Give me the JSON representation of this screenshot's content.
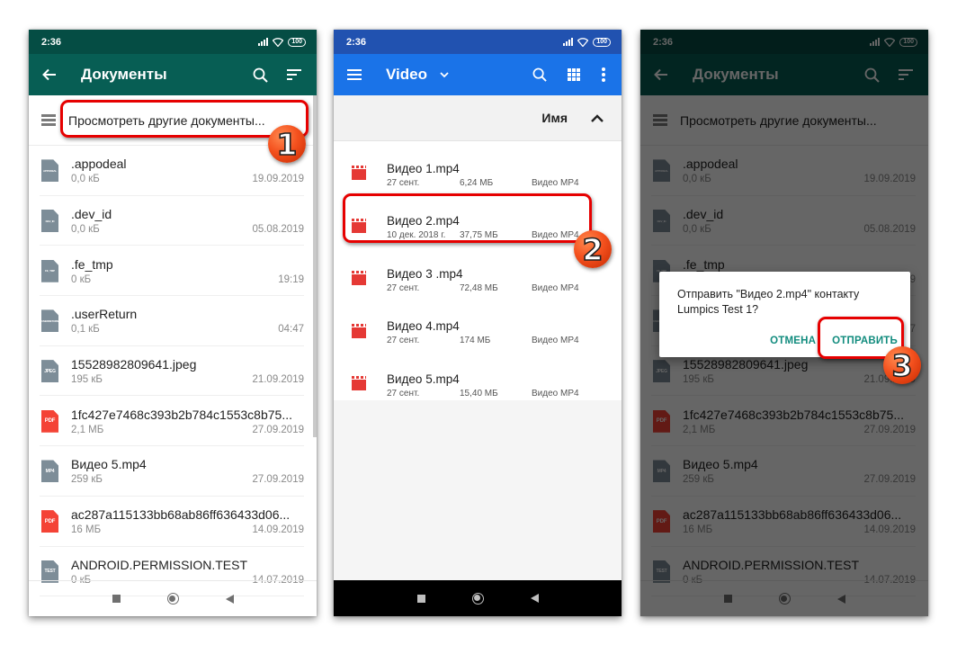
{
  "panels": {
    "documents": {
      "status": {
        "time": "2:36",
        "battery": "100"
      },
      "appbar": {
        "title": "Документы",
        "back_icon": "arrow-back-icon",
        "search_icon": "search-icon",
        "sort_icon": "sort-icon"
      },
      "browse_label": "Просмотреть другие документы...",
      "files": [
        {
          "name": ".appodeal",
          "size": "0,0 кБ",
          "date": "19.09.2019",
          "icon_label": "APPODEAL",
          "icon_color": "#7d8d98"
        },
        {
          "name": ".dev_id",
          "size": "0,0 кБ",
          "date": "05.08.2019",
          "icon_label": "DEV_ID",
          "icon_color": "#7d8d98"
        },
        {
          "name": ".fe_tmp",
          "size": "0 кБ",
          "date": "19:19",
          "icon_label": "FE_TMP",
          "icon_color": "#7d8d98"
        },
        {
          "name": ".userReturn",
          "size": "0,1 кБ",
          "date": "04:47",
          "icon_label": "USERRETURN",
          "icon_color": "#7d8d98"
        },
        {
          "name": "15528982809641.jpeg",
          "size": "195 кБ",
          "date": "21.09.2019",
          "icon_label": "JPEG",
          "icon_color": "#7d8d98"
        },
        {
          "name": "1fc427e7468c393b2b784c1553c8b75...",
          "size": "2,1 МБ",
          "date": "27.09.2019",
          "icon_label": "PDF",
          "icon_color": "#f44336"
        },
        {
          "name": "Видео 5.mp4",
          "size": "259 кБ",
          "date": "27.09.2019",
          "icon_label": "MP4",
          "icon_color": "#7d8d98"
        },
        {
          "name": "ac287a115133bb68ab86ff636433d06...",
          "size": "16 МБ",
          "date": "14.09.2019",
          "icon_label": "PDF",
          "icon_color": "#f44336"
        },
        {
          "name": "ANDROID.PERMISSION.TEST",
          "size": "0 кБ",
          "date": "14.07.2019",
          "icon_label": "TEST",
          "icon_color": "#7d8d98"
        }
      ]
    },
    "video": {
      "status": {
        "time": "2:36",
        "battery": "100"
      },
      "appbar": {
        "title": "Video",
        "menu_icon": "hamburger-menu-icon",
        "dropdown_icon": "chevron-down-icon",
        "search_icon": "search-icon",
        "grid_icon": "grid-view-icon",
        "more_icon": "more-vert-icon"
      },
      "sort_label": "Имя",
      "files": [
        {
          "name": "Видео 1.mp4",
          "date": "27 сент.",
          "size": "6,24 МБ",
          "type": "Видео MP4"
        },
        {
          "name": "Видео 2.mp4",
          "date": "10 дек. 2018 г.",
          "size": "37,75 МБ",
          "type": "Видео MP4"
        },
        {
          "name": "Видео 3 .mp4",
          "date": "27 сент.",
          "size": "72,48 МБ",
          "type": "Видео MP4"
        },
        {
          "name": "Видео 4.mp4",
          "date": "27 сент.",
          "size": "174 МБ",
          "type": "Видео MP4"
        },
        {
          "name": "Видео 5.mp4",
          "date": "27 сент.",
          "size": "15,40 МБ",
          "type": "Видео MP4"
        }
      ]
    },
    "confirm": {
      "dialog": {
        "message": "Отправить \"Видео 2.mp4\" контакту Lumpics Test 1?",
        "cancel_label": "ОТМЕНА",
        "send_label": "ОТПРАВИТЬ"
      }
    }
  },
  "callouts": [
    "1",
    "2",
    "3"
  ],
  "colors": {
    "whatsapp_appbar": "#075e54",
    "files_appbar": "#1a73e8",
    "highlight": "#e60000",
    "pdf_red": "#f44336",
    "video_red": "#e53935",
    "accent_text": "#128c7e"
  }
}
